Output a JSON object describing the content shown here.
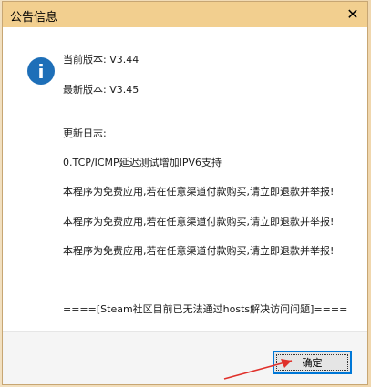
{
  "window": {
    "title": "公告信息",
    "close_glyph": "✕"
  },
  "content": {
    "current_version": "当前版本: V3.44",
    "latest_version": "最新版本: V3.45",
    "changelog_header": "更新日志:",
    "changelog_item": "0.TCP/ICMP延迟测试增加IPV6支持",
    "notices": [
      "本程序为免费应用,若在任意渠道付款购买,请立即退款并举报!",
      "本程序为免费应用,若在任意渠道付款购买,请立即退款并举报!",
      "本程序为免费应用,若在任意渠道付款购买,请立即退款并举报!"
    ],
    "steam_notice": "====[Steam社区目前已无法通过hosts解决访问问题]===="
  },
  "footer": {
    "ok_label": "确定"
  },
  "colors": {
    "titlebar": "#f2cf8f",
    "info_icon": "#1e6fb8",
    "button_border": "#0078d7",
    "arrow": "#e0302a"
  },
  "icons": {
    "info": "info-icon",
    "close": "close-icon",
    "arrow": "red-arrow-annotation"
  }
}
